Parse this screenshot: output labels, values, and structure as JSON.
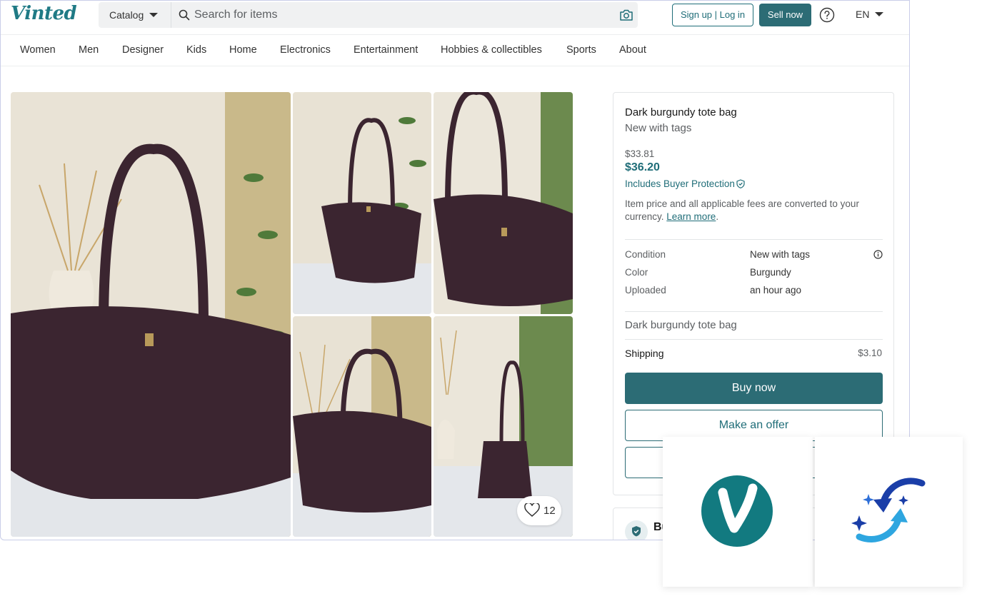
{
  "header": {
    "logo": "Vinted",
    "catalog_label": "Catalog",
    "search_placeholder": "Search for items",
    "signup_label": "Sign up | Log in",
    "sell_label": "Sell now",
    "language": "EN"
  },
  "nav": {
    "items": [
      "Women",
      "Men",
      "Designer",
      "Kids",
      "Home",
      "Electronics",
      "Entertainment",
      "Hobbies & collectibles",
      "Sports",
      "About"
    ]
  },
  "gallery": {
    "like_count": "12"
  },
  "item": {
    "title": "Dark burgundy tote bag",
    "condition_subtitle": "New with tags",
    "price": "$33.81",
    "total_price": "$36.20",
    "protection_text": "Includes Buyer Protection",
    "note_text": "Item price and all applicable fees are converted to your currency.",
    "learn_more": "Learn more",
    "details": [
      {
        "label": "Condition",
        "value": "New with tags"
      },
      {
        "label": "Color",
        "value": "Burgundy"
      },
      {
        "label": "Uploaded",
        "value": "an hour ago"
      }
    ],
    "description": "Dark burgundy tote bag",
    "shipping_label": "Shipping",
    "shipping_value": "$3.10",
    "buy_label": "Buy now",
    "offer_label": "Make an offer",
    "protection_card_title": "Bu"
  },
  "colors": {
    "brand": "#2c6c75",
    "accent_text": "#1f6d78",
    "bag": "#3b2530"
  },
  "icons": [
    "search-icon",
    "camera-icon",
    "help-icon",
    "heart-icon",
    "shield-icon",
    "info-icon",
    "vinted-logo-icon",
    "refresh-sparkle-icon"
  ]
}
